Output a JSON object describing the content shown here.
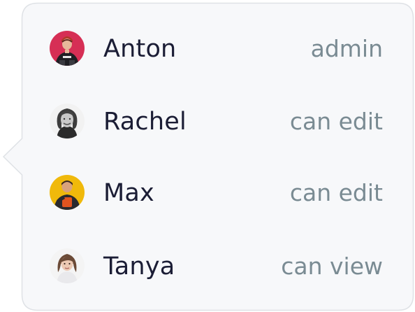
{
  "members": [
    {
      "name": "Anton",
      "role": "admin",
      "avatar_bg": "#d62f55"
    },
    {
      "name": "Rachel",
      "role": "can edit",
      "avatar_bg": "#f2f2f2"
    },
    {
      "name": "Max",
      "role": "can edit",
      "avatar_bg": "#f0b90b"
    },
    {
      "name": "Tanya",
      "role": "can view",
      "avatar_bg": "#f4f4f4"
    }
  ],
  "colors": {
    "panel_bg": "#f7f8fa",
    "panel_border": "#dfe2e6",
    "name_text": "#1b1d35",
    "role_text": "#7a8b93"
  }
}
